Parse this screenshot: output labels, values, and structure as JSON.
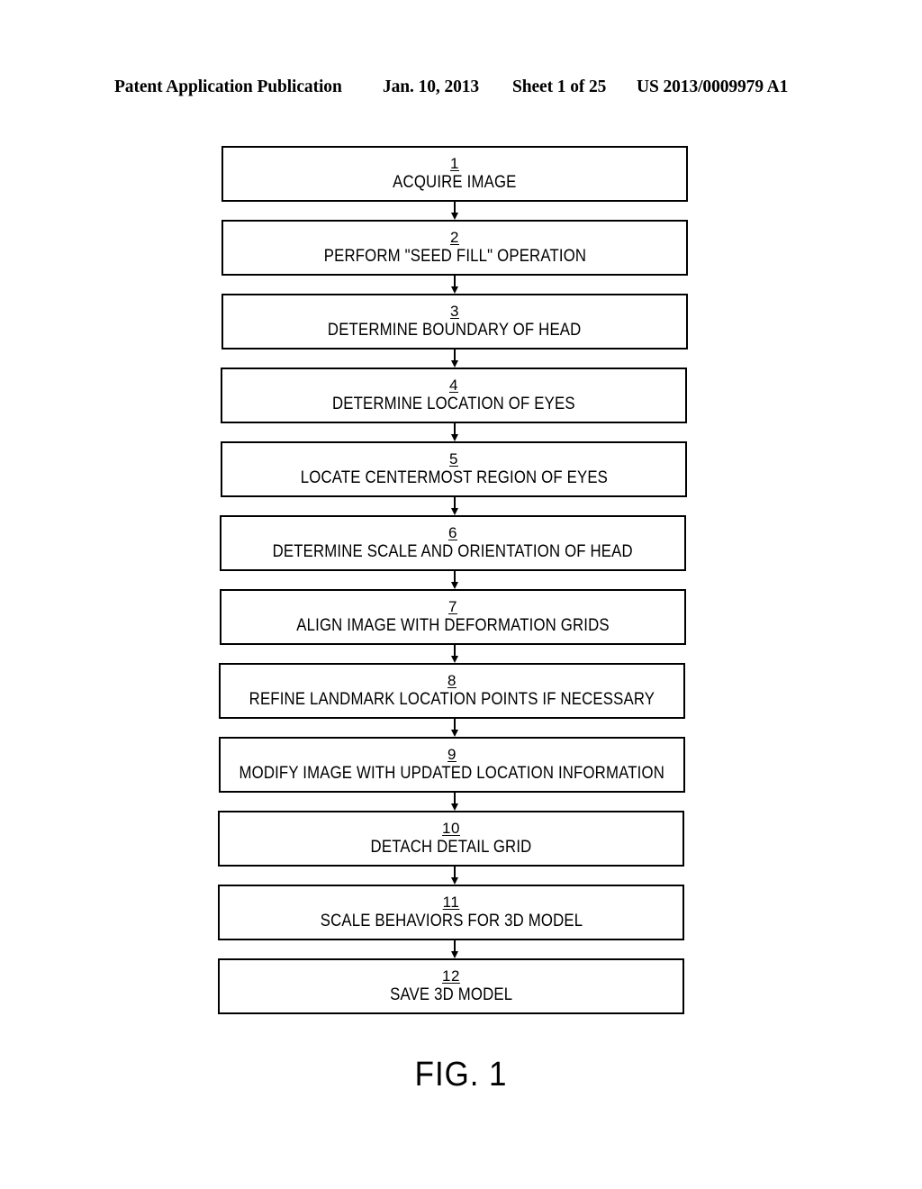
{
  "header": {
    "publication": "Patent Application Publication",
    "date": "Jan. 10, 2013",
    "sheet": "Sheet 1 of 25",
    "patent_number": "US 2013/0009979 A1"
  },
  "figure": {
    "caption": "FIG. 1",
    "type": "flowchart",
    "orientation": "vertical",
    "connector": "downward-arrow",
    "steps": [
      {
        "num": "1",
        "label": "ACQUIRE IMAGE"
      },
      {
        "num": "2",
        "label": "PERFORM \"SEED FILL\" OPERATION"
      },
      {
        "num": "3",
        "label": "DETERMINE BOUNDARY OF HEAD"
      },
      {
        "num": "4",
        "label": "DETERMINE LOCATION OF EYES"
      },
      {
        "num": "5",
        "label": "LOCATE CENTERMOST REGION OF EYES"
      },
      {
        "num": "6",
        "label": "DETERMINE SCALE AND ORIENTATION OF HEAD"
      },
      {
        "num": "7",
        "label": "ALIGN IMAGE WITH DEFORMATION GRIDS"
      },
      {
        "num": "8",
        "label": "REFINE LANDMARK LOCATION POINTS IF NECESSARY"
      },
      {
        "num": "9",
        "label": "MODIFY IMAGE WITH UPDATED LOCATION INFORMATION"
      },
      {
        "num": "10",
        "label": "DETACH DETAIL GRID"
      },
      {
        "num": "11",
        "label": "SCALE BEHAVIORS FOR 3D MODEL"
      },
      {
        "num": "12",
        "label": "SAVE 3D MODEL"
      }
    ]
  },
  "colors": {
    "ink": "#000000",
    "paper": "#ffffff"
  }
}
